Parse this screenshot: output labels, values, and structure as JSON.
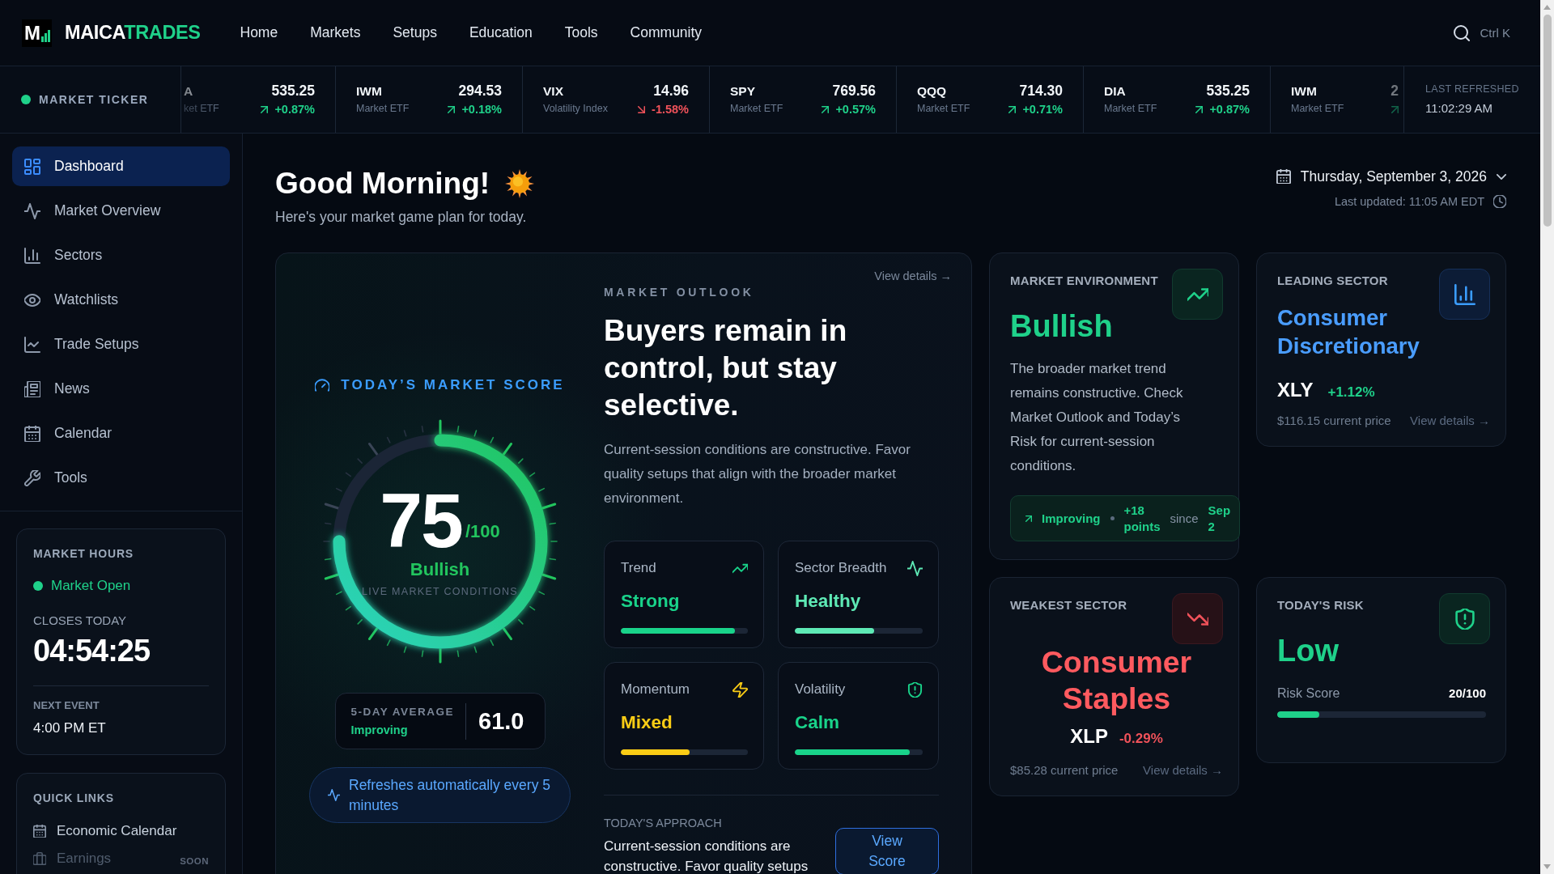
{
  "brand": {
    "mark": "M",
    "name": "MAICA",
    "accent": "TRADES"
  },
  "nav": [
    "Home",
    "Markets",
    "Setups",
    "Education",
    "Tools",
    "Community"
  ],
  "search": {
    "shortcut": "Ctrl K"
  },
  "ticker": {
    "label": "MARKET TICKER",
    "items": [
      {
        "symbol": "A",
        "name": "ket ETF",
        "price": "535.25",
        "change": "+0.87%",
        "positive": true
      },
      {
        "symbol": "IWM",
        "name": "Market ETF",
        "price": "294.53",
        "change": "+0.18%",
        "positive": true
      },
      {
        "symbol": "VIX",
        "name": "Volatility Index",
        "price": "14.96",
        "change": "-1.58%",
        "positive": false
      },
      {
        "symbol": "SPY",
        "name": "Market ETF",
        "price": "769.56",
        "change": "+0.57%",
        "positive": true
      },
      {
        "symbol": "QQQ",
        "name": "Market ETF",
        "price": "714.30",
        "change": "+0.71%",
        "positive": true
      },
      {
        "symbol": "DIA",
        "name": "Market ETF",
        "price": "535.25",
        "change": "+0.87%",
        "positive": true
      },
      {
        "symbol": "IWM",
        "name": "Market ETF",
        "price": "2",
        "positive": true
      }
    ],
    "last_refreshed": {
      "label": "LAST REFRESHED",
      "time": "11:02:29 AM"
    }
  },
  "sidebar": {
    "items": [
      {
        "label": "Dashboard",
        "selected": true
      },
      {
        "label": "Market Overview",
        "selected": false
      },
      {
        "label": "Sectors",
        "selected": false
      },
      {
        "label": "Watchlists",
        "selected": false
      },
      {
        "label": "Trade Setups",
        "selected": false
      },
      {
        "label": "News",
        "selected": false
      },
      {
        "label": "Calendar",
        "selected": false
      },
      {
        "label": "Tools",
        "selected": false
      }
    ],
    "market_hours": {
      "title": "MARKET HOURS",
      "status": "Market Open",
      "open": true,
      "closes_label": "CLOSES TODAY",
      "countdown": "04:54:25",
      "next_label": "NEXT EVENT",
      "next_event": "4:00 PM ET"
    },
    "quick_links": {
      "title": "QUICK LINKS",
      "items": [
        {
          "label": "Economic Calendar",
          "disabled": false
        },
        {
          "label": "Earnings",
          "disabled": true,
          "badge": "SOON"
        }
      ]
    }
  },
  "greeting": {
    "title": "Good Morning!",
    "subtitle": "Here's your market game plan for today."
  },
  "date_bar": {
    "date": "Thursday, September 3, 2026",
    "last_updated": "Last updated: 11:05 AM EDT"
  },
  "score_card": {
    "title": "TODAY’S MARKET SCORE",
    "score": "75",
    "max": "/100",
    "rating": "Bullish",
    "caption": "LIVE MARKET CONDITIONS",
    "level": 0.75,
    "average": {
      "label": "5-DAY AVERAGE",
      "trend": "Improving",
      "value": "61.0"
    },
    "refresh_note": "Refreshes automatically every 5 minutes"
  },
  "outlook": {
    "link": "View details →",
    "label": "MARKET OUTLOOK",
    "headline": "Buyers remain in control, but stay selective.",
    "summary": "Current-session conditions are constructive. Favor quality setups that align with the broader market environment.",
    "metrics": [
      {
        "label": "Trend",
        "value": "Strong",
        "level": 0.9,
        "color": "#19d38a"
      },
      {
        "label": "Sector Breadth",
        "value": "Healthy",
        "level": 0.62,
        "color": "#5ee9b5"
      },
      {
        "label": "Momentum",
        "value": "Mixed",
        "level": 0.54,
        "color": "#facc15"
      },
      {
        "label": "Volatility",
        "value": "Calm",
        "level": 0.9,
        "color": "#19d38a"
      }
    ],
    "approach": {
      "label": "TODAY'S APPROACH",
      "text": "Current-session conditions are constructive. Favor quality setups",
      "button": "View Score"
    }
  },
  "market_environment": {
    "title": "MARKET ENVIRONMENT",
    "rating": "Bullish",
    "summary": "The broader market trend remains constructive. Check Market Outlook and Today’s Risk for current-session conditions.",
    "change": {
      "trend": "Improving",
      "amount": "+18 points",
      "since": "since",
      "date": "Sep 2"
    }
  },
  "leading_sector": {
    "title": "LEADING SECTOR",
    "name": "Consumer Discretionary",
    "symbol": "XLY",
    "change": "+1.12%",
    "positive": true,
    "price": "$116.15 current price",
    "link": "View details →"
  },
  "weakest_sector": {
    "title": "WEAKEST SECTOR",
    "name": "Consumer Staples",
    "symbol": "XLP",
    "change": "-0.29%",
    "positive": false,
    "price": "$85.28 current price",
    "link": "View details →"
  },
  "todays_risk": {
    "title": "TODAY'S RISK",
    "rating": "Low",
    "score_label": "Risk Score",
    "score": "20/100",
    "level": 0.2
  }
}
